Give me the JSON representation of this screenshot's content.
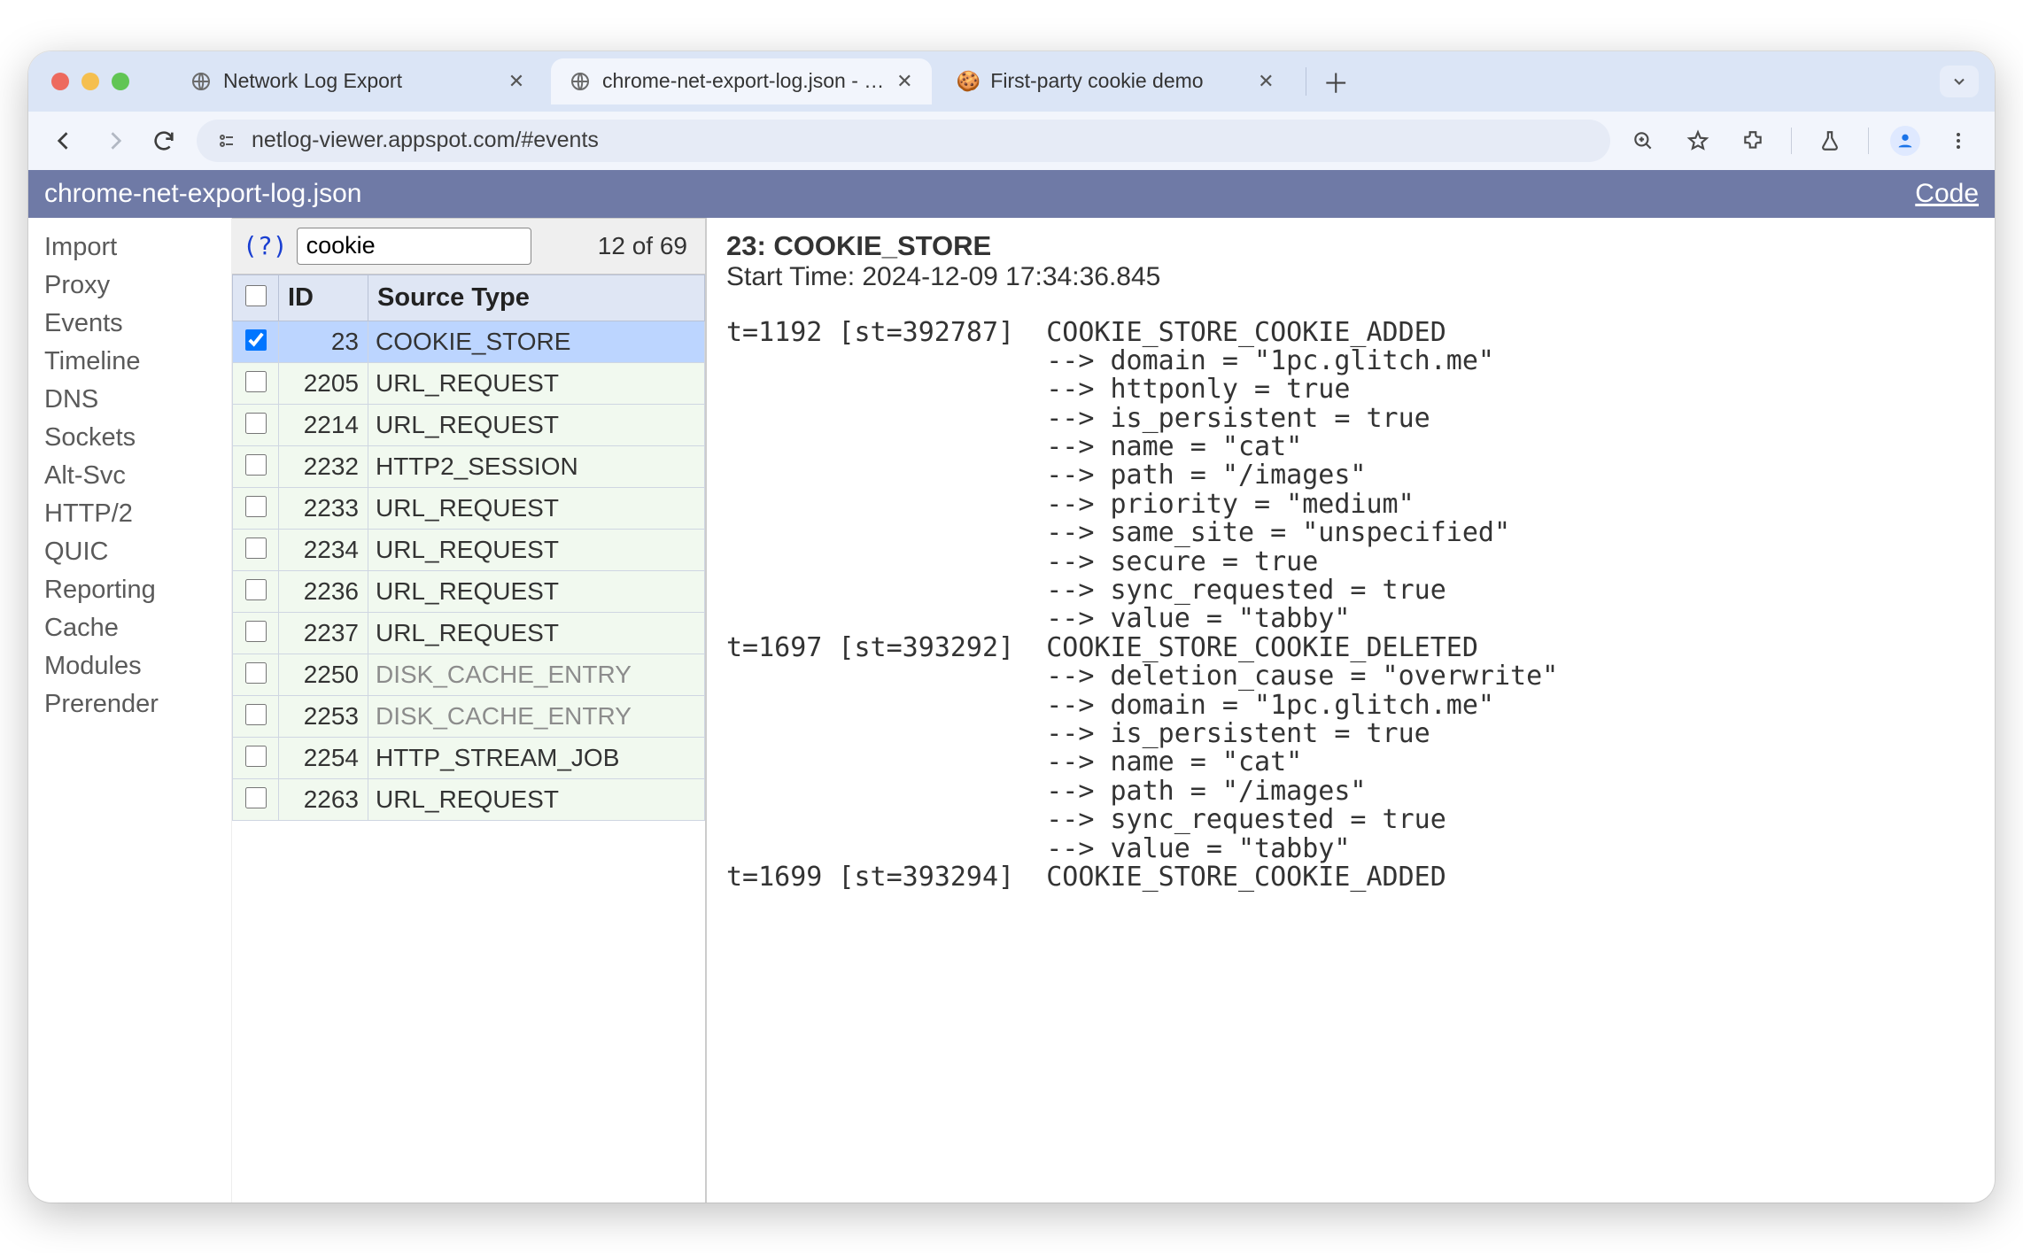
{
  "tabs": [
    {
      "title": "Network Log Export",
      "fav": "globe"
    },
    {
      "title": "chrome-net-export-log.json - …",
      "fav": "globe"
    },
    {
      "title": "First-party cookie demo",
      "fav": "cookie"
    }
  ],
  "url_display": "netlog-viewer.appspot.com/#events",
  "banner": {
    "filename": "chrome-net-export-log.json",
    "code_label": "Code"
  },
  "sidebar": {
    "items": [
      "Import",
      "Proxy",
      "Events",
      "Timeline",
      "DNS",
      "Sockets",
      "Alt-Svc",
      "HTTP/2",
      "QUIC",
      "Reporting",
      "Cache",
      "Modules",
      "Prerender"
    ]
  },
  "filter": {
    "help": "(?)",
    "value": "cookie",
    "count": "12 of 69"
  },
  "columns": {
    "id": "ID",
    "source": "Source Type"
  },
  "rows": [
    {
      "id": "23",
      "type": "COOKIE_STORE",
      "selected": true,
      "dim": false
    },
    {
      "id": "2205",
      "type": "URL_REQUEST",
      "selected": false,
      "dim": false
    },
    {
      "id": "2214",
      "type": "URL_REQUEST",
      "selected": false,
      "dim": false
    },
    {
      "id": "2232",
      "type": "HTTP2_SESSION",
      "selected": false,
      "dim": false
    },
    {
      "id": "2233",
      "type": "URL_REQUEST",
      "selected": false,
      "dim": false
    },
    {
      "id": "2234",
      "type": "URL_REQUEST",
      "selected": false,
      "dim": false
    },
    {
      "id": "2236",
      "type": "URL_REQUEST",
      "selected": false,
      "dim": false
    },
    {
      "id": "2237",
      "type": "URL_REQUEST",
      "selected": false,
      "dim": false
    },
    {
      "id": "2250",
      "type": "DISK_CACHE_ENTRY",
      "selected": false,
      "dim": true
    },
    {
      "id": "2253",
      "type": "DISK_CACHE_ENTRY",
      "selected": false,
      "dim": true
    },
    {
      "id": "2254",
      "type": "HTTP_STREAM_JOB",
      "selected": false,
      "dim": false
    },
    {
      "id": "2263",
      "type": "URL_REQUEST",
      "selected": false,
      "dim": false
    }
  ],
  "details": {
    "title": "23: COOKIE_STORE",
    "start": "Start Time: 2024-12-09 17:34:36.845",
    "log": "t=1192 [st=392787]  COOKIE_STORE_COOKIE_ADDED\n                    --> domain = \"1pc.glitch.me\"\n                    --> httponly = true\n                    --> is_persistent = true\n                    --> name = \"cat\"\n                    --> path = \"/images\"\n                    --> priority = \"medium\"\n                    --> same_site = \"unspecified\"\n                    --> secure = true\n                    --> sync_requested = true\n                    --> value = \"tabby\"\nt=1697 [st=393292]  COOKIE_STORE_COOKIE_DELETED\n                    --> deletion_cause = \"overwrite\"\n                    --> domain = \"1pc.glitch.me\"\n                    --> is_persistent = true\n                    --> name = \"cat\"\n                    --> path = \"/images\"\n                    --> sync_requested = true\n                    --> value = \"tabby\"\nt=1699 [st=393294]  COOKIE_STORE_COOKIE_ADDED"
  }
}
